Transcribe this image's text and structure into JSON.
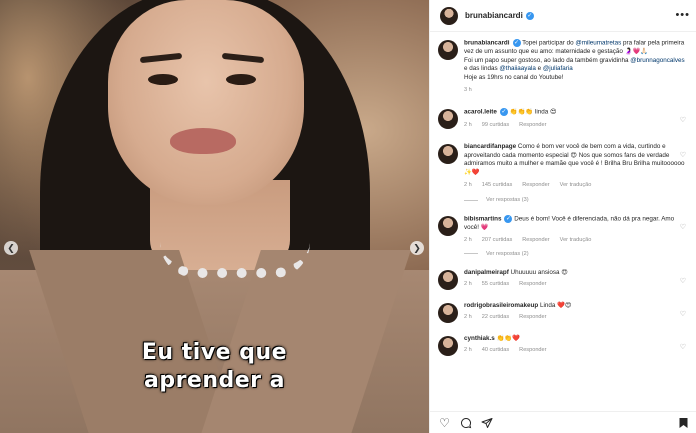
{
  "post": {
    "caption_line1": "Eu tive que",
    "caption_line2": "aprender a"
  },
  "header": {
    "username": "brunabiancardi",
    "more": "•••"
  },
  "description": {
    "username": "brunabiancardi",
    "text_a": " Topei participar do ",
    "mention1": "@mileumatretas",
    "text_b": " pra falar pela primeira vez de um assunto que eu amo: maternidade e gestação 🤰🏻💗🙏🏻",
    "text_c": "Foi um papo super gostoso, ao lado da também gravidinha ",
    "mention2": "@brunnagoncalves",
    "text_d": " e das lindas ",
    "mention3": "@thaiiaayala",
    "text_e": " e ",
    "mention4": "@juliafaria",
    "text_f": "Hoje as 19hrs no canal do Youtube!",
    "time": "3 h"
  },
  "comments": [
    {
      "username": "acarol.leite",
      "text": "👏👏👏 linda 😍",
      "time": "2 h",
      "likes": "99 curtidas",
      "reply": "Responder"
    },
    {
      "username": "biancardifanpage",
      "text": "Como é bom ver você de bem com a vida, curtindo e aproveitando cada momento especial 😍 Nos que somos fans de verdade admiramos muito a mulher e mamãe que você é ! Brilha Bru Brilha muitoooooo ✨❤️",
      "time": "2 h",
      "likes": "145 curtidas",
      "reply": "Responder",
      "translate": "Ver tradução",
      "replies": "Ver respostas (3)"
    },
    {
      "username": "bibismartins",
      "text": "Deus é bom! Você é diferenciada, não dá pra negar. Amo você! 💗",
      "time": "2 h",
      "likes": "207 curtidas",
      "reply": "Responder",
      "translate": "Ver tradução",
      "replies": "Ver respostas (2)"
    },
    {
      "username": "danipalmeirapf",
      "text": "Uhuuuuu ansiosa 😍",
      "time": "2 h",
      "likes": "55 curtidas",
      "reply": "Responder"
    },
    {
      "username": "rodrigobrasileiromakeup",
      "text": "Linda ❤️😍",
      "time": "2 h",
      "likes": "22 curtidas",
      "reply": "Responder"
    },
    {
      "username": "cynthiak.s",
      "text": "👏👏❤️",
      "time": "2 h",
      "likes": "40 curtidas",
      "reply": "Responder"
    }
  ],
  "colors": {
    "verified": "#3897f0",
    "mention": "#00376b",
    "meta": "#8e8e8e"
  },
  "icons": [
    "heart-icon",
    "comment-icon",
    "share-icon",
    "bookmark-icon",
    "more-icon",
    "verified-icon"
  ]
}
